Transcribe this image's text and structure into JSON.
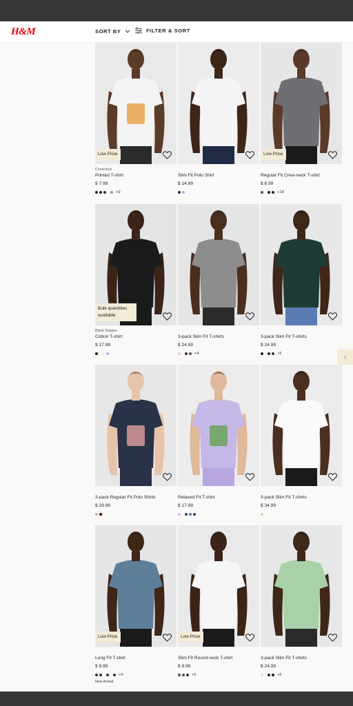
{
  "header": {
    "logo": "H&M",
    "sort_label": "SORT BY",
    "filter_label": "FILTER & SORT"
  },
  "colors": {
    "brand": "#e50010",
    "badge_bg": "#f3ead7",
    "page_bg": "#faf9f8"
  },
  "products": [
    {
      "tag": "Conscious",
      "name": "Printed T-shirt",
      "price": "$ 7.99",
      "badge": "Low Price",
      "swatches": [
        "#222",
        "#222",
        "#333",
        "gap",
        "#999"
      ],
      "more": "+9",
      "sub": ""
    },
    {
      "tag": "",
      "name": "Slim Fit Polo Shirt",
      "price": "$ 14.99",
      "badge": "",
      "swatches": [
        "#1d2d57",
        "#aab4c4"
      ],
      "more": "",
      "sub": ""
    },
    {
      "tag": "",
      "name": "Regular Fit Crew-neck T-shirt",
      "price": "$ 6.99",
      "badge": "Low Price",
      "swatches": [
        "#555",
        "gap",
        "#222",
        "#222"
      ],
      "more": "+18",
      "sub": ""
    },
    {
      "tag": "Blank Staples",
      "name": "Cotton T-shirt",
      "price": "$ 17.99",
      "badge": "Bulk quantities available",
      "swatches": [
        "#111",
        "gap",
        "#eee",
        "#b7a9e8"
      ],
      "more": "",
      "sub": ""
    },
    {
      "tag": "",
      "name": "3-pack Slim Fit T-shirts",
      "price": "$ 24.99",
      "badge": "",
      "swatches": [
        "#e8c7cf",
        "gap",
        "#333",
        "#555"
      ],
      "more": "+4",
      "sub": ""
    },
    {
      "tag": "",
      "name": "3-pack Slim Fit T-shirts",
      "price": "$ 24.99",
      "badge": "",
      "swatches": [
        "#222",
        "gap",
        "#222",
        "#333"
      ],
      "more": "+5",
      "sub": ""
    },
    {
      "tag": "",
      "name": "3-pack Regular Fit Polo Shirts",
      "price": "$ 29.99",
      "badge": "",
      "swatches": [
        "#d9a6a6",
        "#111"
      ],
      "more": "",
      "sub": ""
    },
    {
      "tag": "",
      "name": "Relaxed Fit T-shirt",
      "price": "$ 17.99",
      "badge": "",
      "swatches": [
        "#c7bfe6",
        "gap",
        "#444",
        "#5a76b0",
        "#2a3f6a"
      ],
      "more": "",
      "sub": ""
    },
    {
      "tag": "",
      "name": "5-pack Slim Fit T-shirts",
      "price": "$ 34.99",
      "badge": "",
      "swatches": [
        "#d9d6a8"
      ],
      "more": "",
      "sub": ""
    },
    {
      "tag": "",
      "name": "Long Fit T-shirt",
      "price": "$ 9.99",
      "badge": "Low Price",
      "swatches": [
        "#333",
        "#333",
        "gap",
        "#333",
        "gap",
        "#333"
      ],
      "more": "+9",
      "sub": "New Arrival"
    },
    {
      "tag": "",
      "name": "Slim Fit Round-neck T-shirt",
      "price": "$ 9.99",
      "badge": "Low Price",
      "swatches": [
        "#555",
        "#555",
        "#333"
      ],
      "more": "+5",
      "sub": ""
    },
    {
      "tag": "",
      "name": "3-pack Slim Fit T-shirts",
      "price": "$ 24.99",
      "badge": "",
      "swatches": [
        "#ddd",
        "gap",
        "#222",
        "#222"
      ],
      "more": "+5",
      "sub": ""
    }
  ],
  "photos": [
    {
      "bg": "#e9e9e9",
      "shirt": "#f4f4f4",
      "skin": "#5a3a28",
      "pants": "#2b2b2b",
      "print": "#e8a54a",
      "icon": "backpack-tee-photo-icon"
    },
    {
      "bg": "#ececec",
      "shirt": "#f5f5f5",
      "skin": "#3d2618",
      "pants": "#1f2a44",
      "print": "",
      "icon": "polo-shirt-photo-icon"
    },
    {
      "bg": "#e6e6e6",
      "shirt": "#6e6f72",
      "skin": "#5a3a28",
      "pants": "#1a1a1a",
      "print": "",
      "icon": "grey-tee-photo-icon"
    },
    {
      "bg": "#e4e4e4",
      "shirt": "#1a1a1a",
      "skin": "#3a2418",
      "pants": "#1a1a1a",
      "print": "",
      "icon": "black-tee-photo-icon"
    },
    {
      "bg": "#e5e5e5",
      "shirt": "#8d8d8d",
      "skin": "#4a2e1e",
      "pants": "#2a2a2a",
      "print": "",
      "icon": "grey-vneck-photo-icon"
    },
    {
      "bg": "#e8e8e8",
      "shirt": "#1e3b36",
      "skin": "#3e2619",
      "pants": "#5a7bb3",
      "print": "",
      "icon": "green-tee-photo-icon"
    },
    {
      "bg": "#e7e7e7",
      "shirt": "#2a3248",
      "skin": "#e7c3a9",
      "pants": "#2a3248",
      "print": "#d79a9a",
      "icon": "navy-jacket-photo-icon"
    },
    {
      "bg": "#ececec",
      "shirt": "#c6b8e6",
      "skin": "#e0b89a",
      "pants": "#b7a6e0",
      "print": "#6aa35a",
      "icon": "lilac-tee-photo-icon"
    },
    {
      "bg": "#ebebeb",
      "shirt": "#fafafa",
      "skin": "#4a2e1e",
      "pants": "#1a1a1a",
      "print": "",
      "icon": "white-tee-photo-icon"
    },
    {
      "bg": "#e6e6e6",
      "shirt": "#5e7f99",
      "skin": "#3e2619",
      "pants": "#1a1a1a",
      "print": "",
      "icon": "blue-tee-photo-icon"
    },
    {
      "bg": "#e9e9e9",
      "shirt": "#f6f6f6",
      "skin": "#3b2417",
      "pants": "#1a1a1a",
      "print": "",
      "icon": "white-roundneck-photo-icon"
    },
    {
      "bg": "#e7e7e7",
      "shirt": "#a9d1a8",
      "skin": "#3e2619",
      "pants": "#2a2a2a",
      "print": "",
      "icon": "mint-tee-photo-icon"
    }
  ]
}
